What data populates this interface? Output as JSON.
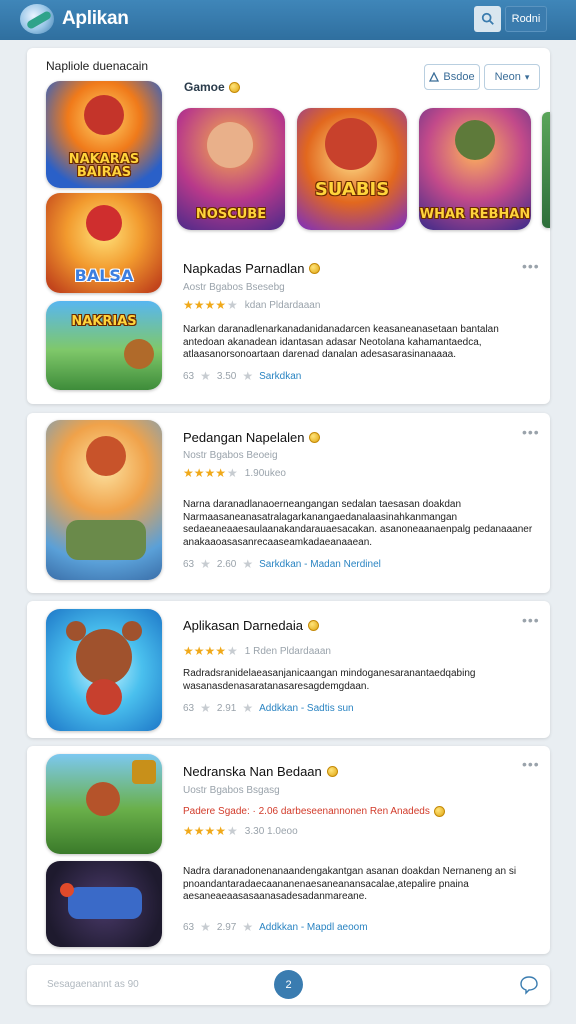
{
  "header": {
    "title": "Aplikan",
    "button_label": "Rodni",
    "icons": {
      "logo": "globe-logo",
      "search": "search-icon"
    }
  },
  "featured": {
    "section_label": "Napliole duenacain",
    "subheading": "Gamoe",
    "pill_left": "Bsdoe",
    "pill_right": "Neon",
    "thumbs_left": [
      {
        "caption": "NAKARAS BAIRAS"
      },
      {
        "caption": "BALSA"
      },
      {
        "caption": "NAKRIAS"
      }
    ],
    "thumbs_row": [
      {
        "caption": "NOSCUBE"
      },
      {
        "caption": "SUABIS"
      },
      {
        "caption": "WHAR REBHAN"
      }
    ],
    "app": {
      "title": "Napkadas Parnadlan",
      "meta": "Aostr  Bgabos  Bsesebg",
      "rating_text": "kdan  Pldardaaan",
      "description": "Narkan daranadlenarkanadanidanadarcen keasaneanasetaan bantalan antedoan akanadean idantasan adasar Neotolana kahamantaedca, atlaasanorsonoartaan darenad danalan adesasarasinanaaaa.",
      "footer_count": "63",
      "footer_value": "3.50",
      "footer_link": "Sarkdkan"
    }
  },
  "apps": [
    {
      "title": "Pedangan Napelalen",
      "meta": "Nostr  Bgabos  Beoeig",
      "rating_text": "1.90ukeo",
      "description": "Narna  daranadlanaoerneangangan sedalan taesasan doakdan Narmaasaneanasatralagarkanangaedanalaasinahkanmangan sedaeaneaaesaulaanakandarauaesacakan. asanoneaanaenpalg pedanaaaner anakaaoasasanrecaaseamkadaeanaaean.",
      "footer_count": "63",
      "footer_value": "2.60",
      "footer_link": "Sarkdkan - Madan Nerdinel"
    },
    {
      "title": "Aplikasan Darnedaia",
      "rating_text": "1  Rden  Pldardaaan",
      "description": "Radradsranidelaeasanjanicaangan mindoganesaranantaedqabing wasanasdenasaratanasaresagdemgdaan.",
      "footer_count": "63",
      "footer_value": "2.91",
      "footer_link": "Addkkan - Sadtis sun"
    },
    {
      "title": "Nedranska Nan Bedaan",
      "meta": "Uostr  Bgabos  Bsgasg",
      "promo": "Padere Sgade:  · 2.06 darbeseenannonen Ren Anadeds",
      "rating_text": "3.30 1.0eoo",
      "description": "Nadra daranadonenanaandengakantgan asanan doakdan Nernaneng an si pnoandantaradaecaananenaesaneanansacalae,atepalire pnaina aesaneaeaasasaanasadesadanmareane.",
      "footer_count": "63",
      "footer_value": "2.97",
      "footer_link": "Addkkan - Mapdl aeoom"
    }
  ],
  "bottom": {
    "text": "Sesagaenannt as  90",
    "fab_label": "2"
  },
  "colors": {
    "header": "#3f86b9",
    "accent": "#2a84c2",
    "star": "#f0a91a",
    "promo": "#d23b2a"
  }
}
